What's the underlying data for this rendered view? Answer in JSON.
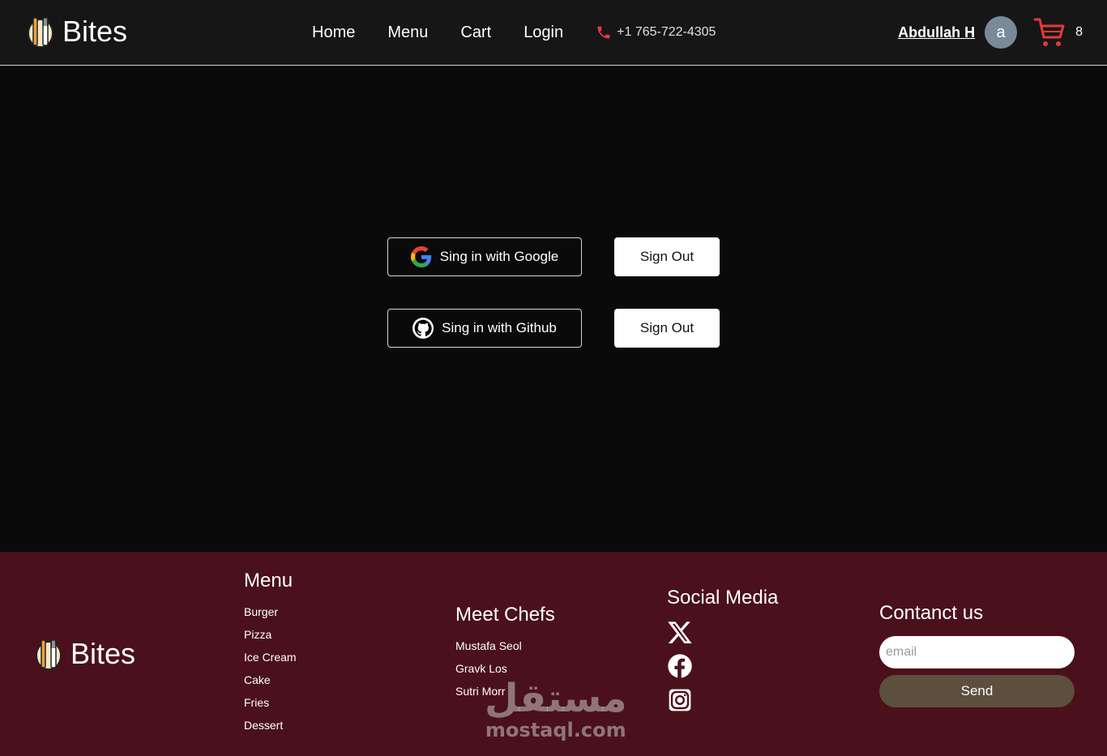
{
  "header": {
    "brand": "Bites",
    "nav": [
      "Home",
      "Menu",
      "Cart",
      "Login"
    ],
    "phone": "+1 765-722-4305",
    "user_name": "Abdullah H",
    "avatar_letter": "a",
    "cart_count": "8"
  },
  "auth": {
    "google_label": "Sing in with Google",
    "github_label": "Sing in with Github",
    "signout_label": "Sign Out"
  },
  "footer": {
    "brand": "Bites",
    "menu_title": "Menu",
    "menu_items": [
      "Burger",
      "Pizza",
      "Ice Cream",
      "Cake",
      "Fries",
      "Dessert"
    ],
    "chefs_title": "Meet Chefs",
    "chefs": [
      "Mustafa Seol",
      "Gravk Los",
      "Sutri Morr"
    ],
    "social_title": "Social Media",
    "social_icons": [
      "x-icon",
      "facebook-icon",
      "instagram-icon"
    ],
    "contact_title": "Contanct us",
    "email_placeholder": "email",
    "send_label": "Send"
  },
  "watermark": {
    "arabic": "مستقل",
    "latin": "mostaql.com"
  },
  "colors": {
    "header_bg": "#161616",
    "page_bg": "#0a0a0a",
    "footer_bg": "#4a111c",
    "accent_red": "#e53935",
    "send_button": "#5c4f3d"
  }
}
